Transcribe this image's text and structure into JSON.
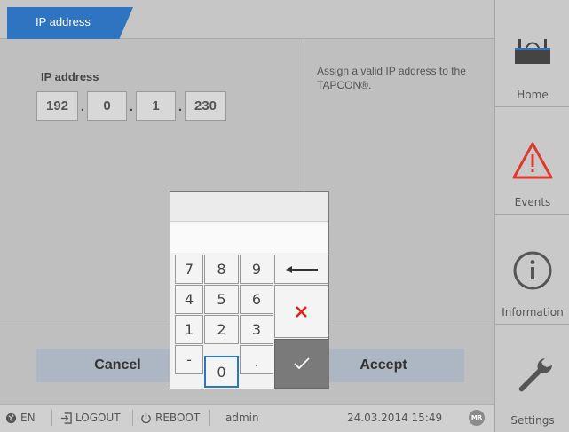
{
  "tab": {
    "title": "IP address"
  },
  "ip": {
    "label": "IP address",
    "octets": [
      "192",
      "0",
      "1",
      "230"
    ],
    "separator": "."
  },
  "help": {
    "text": "Assign a valid IP address to the TAPCON®."
  },
  "buttons": {
    "cancel": "Cancel",
    "accept": "Accept"
  },
  "keypad": {
    "display_top": "",
    "display_value": "",
    "keys": {
      "k7": "7",
      "k8": "8",
      "k9": "9",
      "k4": "4",
      "k5": "5",
      "k6": "6",
      "k1": "1",
      "k2": "2",
      "k3": "3",
      "minus": "-",
      "k0": "0",
      "dot": "."
    },
    "backspace_icon": "arrow-left-icon",
    "clear_icon": "x-icon",
    "confirm_icon": "checkmark-icon"
  },
  "statusbar": {
    "language": "EN",
    "logout": "LOGOUT",
    "reboot": "REBOOT",
    "user": "admin",
    "datetime": "24.03.2014 15:49",
    "brand_badge": "MR"
  },
  "nav": {
    "home": "Home",
    "events": "Events",
    "information": "Information",
    "settings": "Settings"
  },
  "colors": {
    "accent": "#2f74c0",
    "warning": "#e03a2f",
    "clear_x": "#d9261c",
    "button_bg": "#adb7c4"
  }
}
